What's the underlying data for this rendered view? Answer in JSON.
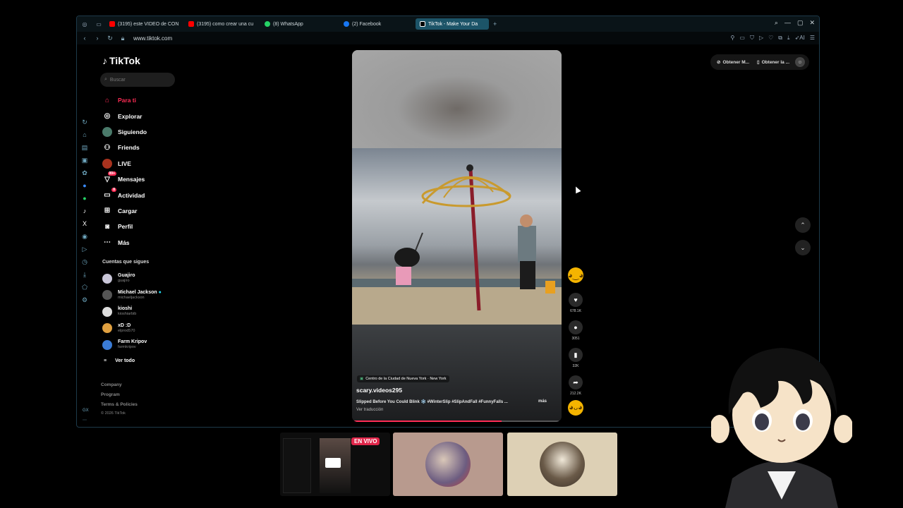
{
  "browser": {
    "tabs": [
      {
        "label": "(3195) este VIDEO de CON",
        "color": "#ff0000"
      },
      {
        "label": "(3195) como crear una cu",
        "color": "#ff0000"
      },
      {
        "label": "(8) WhatsApp",
        "color": "#25d366"
      },
      {
        "label": "(2) Facebook",
        "color": "#1877f2"
      },
      {
        "label": "TikTok - Make Your Da",
        "color": "#ffffff",
        "active": true
      }
    ],
    "new_tab": "+",
    "url": "www.tiktok.com",
    "ai_label": "AI"
  },
  "tiktok": {
    "logo": "TikTok",
    "search_placeholder": "Buscar",
    "menu": [
      {
        "label": "Para ti",
        "icon": "home-icon",
        "active": true
      },
      {
        "label": "Explorar",
        "icon": "compass-icon"
      },
      {
        "label": "Siguiendo",
        "icon": "following-avatar-icon"
      },
      {
        "label": "Friends",
        "icon": "friends-icon"
      },
      {
        "label": "LIVE",
        "icon": "live-icon"
      },
      {
        "label": "Mensajes",
        "icon": "messages-icon",
        "badge": "99+"
      },
      {
        "label": "Actividad",
        "icon": "activity-icon",
        "badge": "8"
      },
      {
        "label": "Cargar",
        "icon": "upload-icon"
      },
      {
        "label": "Perfil",
        "icon": "profile-icon"
      },
      {
        "label": "Más",
        "icon": "more-icon"
      }
    ],
    "following_header": "Cuentas que sigues",
    "following": [
      {
        "name": "Guajiro",
        "user": "guajiro",
        "color": "#c9c6d8"
      },
      {
        "name": "Michael Jackson",
        "user": "michaeljackson",
        "color": "#555555",
        "verified": true
      },
      {
        "name": "kioshi",
        "user": "kioshiarbib",
        "color": "#dddddd"
      },
      {
        "name": "xD :D",
        "user": "elprod570",
        "color": "#e0a040"
      },
      {
        "name": "Farm Kripov",
        "user": "farmkripov",
        "color": "#3a7bd5"
      }
    ],
    "see_all": "Ver todo",
    "footer": [
      "Company",
      "Program",
      "Terms & Policies"
    ],
    "copyright": "© 2026 TikTok",
    "top_right": {
      "get_coins": "Obtener M...",
      "get_app": "Obtener la ..."
    }
  },
  "video": {
    "location": "Centro de la Ciudad de Nueva York · New York",
    "username": "scary.videos295",
    "description": "Slipped Before You Could Blink ❄️ #WinterSlip #SlipAndFall #FunnyFalls ...",
    "more": "más",
    "translate": "Ver traducción",
    "progress": 0.72,
    "likes": "678.1K",
    "comments": "3051",
    "saves": "32K",
    "shares": "212.2K"
  },
  "stream": {
    "live_label": "EN VIVO"
  }
}
